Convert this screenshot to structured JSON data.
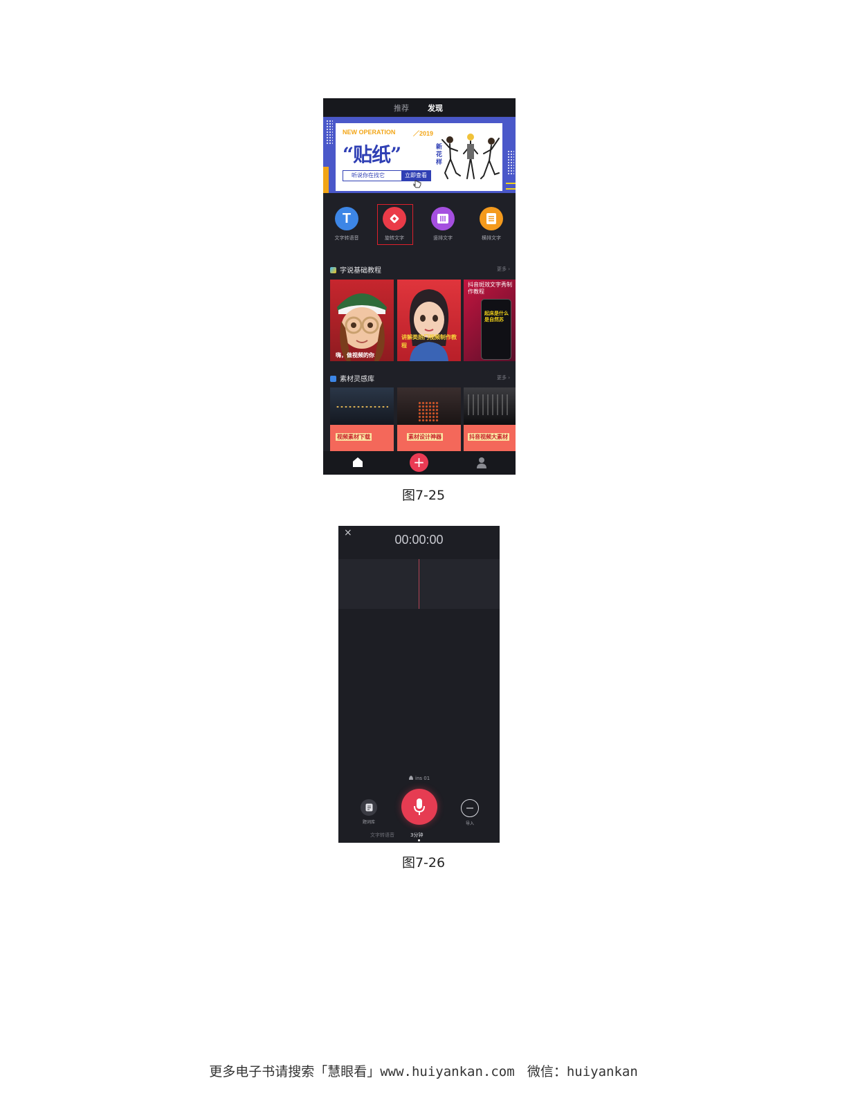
{
  "figure1": {
    "top_tabs": [
      "推荐",
      "发现"
    ],
    "banner": {
      "kicker": "NEW OPERATION",
      "year": "／2019",
      "title": "“贴纸”",
      "side_text": "新花样",
      "button_left": "听说你在找它",
      "button_right": "立即查看"
    },
    "tools": [
      {
        "label": "文字转语音",
        "icon": "t-letter-icon",
        "color": "#3d86e6"
      },
      {
        "label": "旋转文字",
        "icon": "rotate-text-icon",
        "color": "#ea3b48"
      },
      {
        "label": "竖排文字",
        "icon": "vertical-text-icon",
        "color": "#a54fe0"
      },
      {
        "label": "横排文字",
        "icon": "horizontal-text-icon",
        "color": "#f49a1d"
      }
    ],
    "section1": {
      "title": "字说基础教程",
      "more": "更多 ›"
    },
    "tutorials": [
      {
        "caption": "嗨，做视频的你"
      },
      {
        "caption": "讲解类热门视频制作教程"
      },
      {
        "caption_top": "抖音斑效文字秀制作教程",
        "phone_text": "起床是什么是自然苏"
      }
    ],
    "section2": {
      "title": "素材灵感库",
      "more": "更多 ›"
    },
    "materials": [
      {
        "caption": "视频素材下载"
      },
      {
        "caption": "素材设计神器"
      },
      {
        "caption": "抖音视频大素材"
      }
    ],
    "nav_plus": "+",
    "caption": "图7-25"
  },
  "figure2": {
    "close": "×",
    "timer": "00:00:00",
    "device": "ins 01",
    "left_label": "题词库",
    "right_label": "导入",
    "bottom_tabs": [
      "文字转语音",
      "3分钟"
    ],
    "caption": "图7-26"
  },
  "footer": {
    "text_a": "更多电子书请搜索「慧眼看」",
    "text_b": "www.huiyankan.com",
    "text_c": "微信：",
    "text_d": "huiyankan"
  }
}
